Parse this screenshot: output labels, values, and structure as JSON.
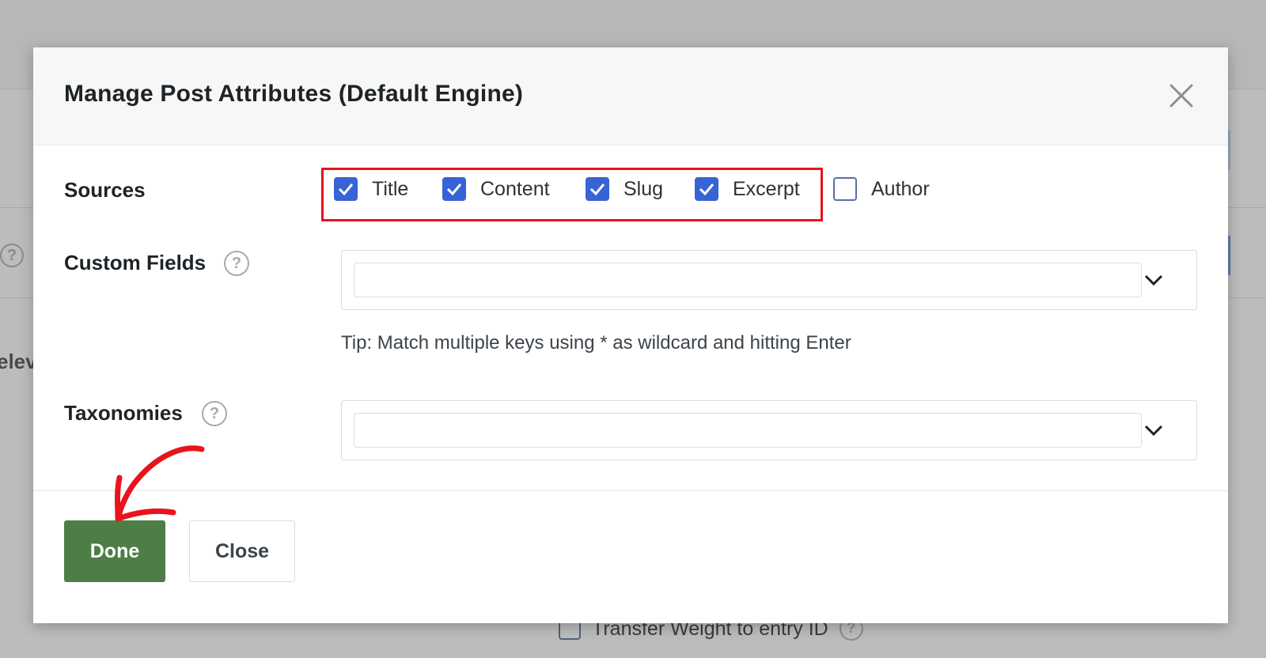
{
  "background": {
    "partial_text": "elev",
    "bottom_option_label": "Transfer Weight to entry ID"
  },
  "modal": {
    "title": "Manage Post Attributes (Default Engine)",
    "sources": {
      "label": "Sources",
      "options": [
        {
          "label": "Title",
          "checked": true
        },
        {
          "label": "Content",
          "checked": true
        },
        {
          "label": "Slug",
          "checked": true
        },
        {
          "label": "Excerpt",
          "checked": true
        },
        {
          "label": "Author",
          "checked": false
        }
      ]
    },
    "custom_fields": {
      "label": "Custom Fields",
      "value": "",
      "tip": "Tip: Match multiple keys using * as wildcard and hitting Enter"
    },
    "taxonomies": {
      "label": "Taxonomies",
      "value": ""
    },
    "help_glyph": "?",
    "buttons": {
      "done_label": "Done",
      "close_label": "Close"
    }
  },
  "colors": {
    "accent_checkbox": "#3763d4",
    "done_button": "#4e7d47",
    "highlight": "#e8141c",
    "annotation_arrow": "#e8141c"
  }
}
